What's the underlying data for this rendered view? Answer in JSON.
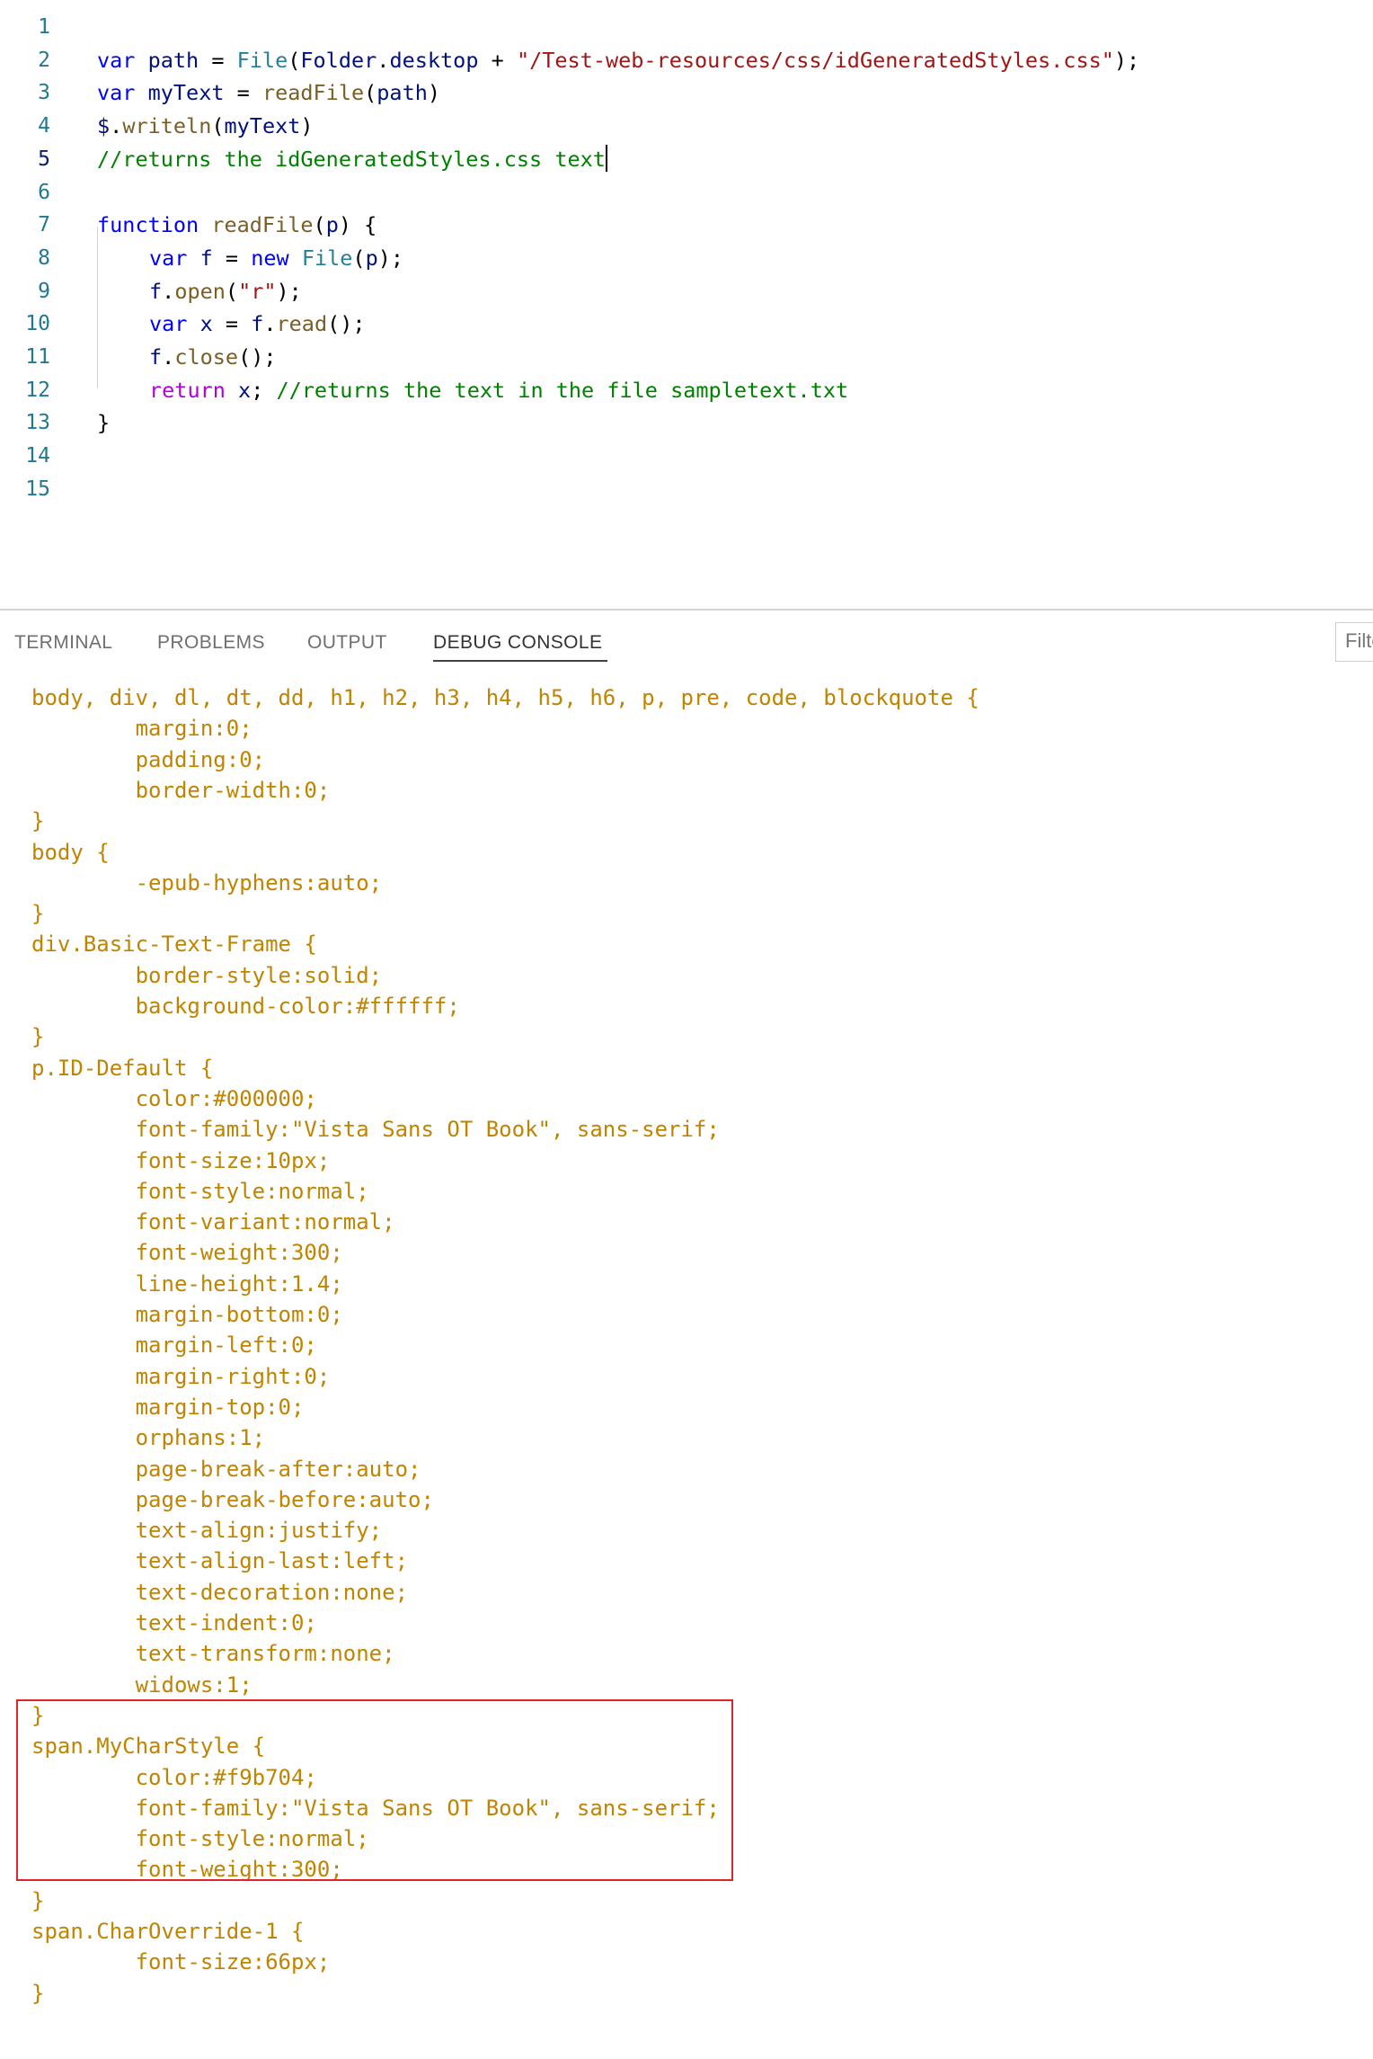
{
  "editor": {
    "line_numbers": [
      "1",
      "2",
      "3",
      "4",
      "5",
      "6",
      "7",
      "8",
      "9",
      "10",
      "11",
      "12",
      "13",
      "14",
      "15"
    ],
    "active_line": 5,
    "lines": [
      [],
      [
        {
          "t": "var",
          "c": "kw"
        },
        {
          "t": " path ",
          "c": "var"
        },
        {
          "t": "= ",
          "c": "plain"
        },
        {
          "t": "File",
          "c": "type"
        },
        {
          "t": "(",
          "c": "plain"
        },
        {
          "t": "Folder",
          "c": "var"
        },
        {
          "t": ".",
          "c": "plain"
        },
        {
          "t": "desktop",
          "c": "var"
        },
        {
          "t": " + ",
          "c": "plain"
        },
        {
          "t": "\"/Test-web-resources/css/idGeneratedStyles.css\"",
          "c": "str"
        },
        {
          "t": ");",
          "c": "plain"
        }
      ],
      [
        {
          "t": "var",
          "c": "kw"
        },
        {
          "t": " myText ",
          "c": "var"
        },
        {
          "t": "= ",
          "c": "plain"
        },
        {
          "t": "readFile",
          "c": "fn"
        },
        {
          "t": "(",
          "c": "plain"
        },
        {
          "t": "path",
          "c": "var"
        },
        {
          "t": ")",
          "c": "plain"
        }
      ],
      [
        {
          "t": "$",
          "c": "var"
        },
        {
          "t": ".",
          "c": "plain"
        },
        {
          "t": "writeln",
          "c": "fn"
        },
        {
          "t": "(",
          "c": "plain"
        },
        {
          "t": "myText",
          "c": "var"
        },
        {
          "t": ")",
          "c": "plain"
        }
      ],
      [
        {
          "t": "//returns the idGeneratedStyles.css text",
          "c": "cmt"
        }
      ],
      [],
      [
        {
          "t": "function",
          "c": "kw"
        },
        {
          "t": " ",
          "c": "plain"
        },
        {
          "t": "readFile",
          "c": "fn"
        },
        {
          "t": "(",
          "c": "plain"
        },
        {
          "t": "p",
          "c": "var"
        },
        {
          "t": ") {",
          "c": "plain"
        }
      ],
      [
        {
          "t": "var",
          "c": "kw"
        },
        {
          "t": " f ",
          "c": "var"
        },
        {
          "t": "= ",
          "c": "plain"
        },
        {
          "t": "new",
          "c": "kw"
        },
        {
          "t": " ",
          "c": "plain"
        },
        {
          "t": "File",
          "c": "type"
        },
        {
          "t": "(",
          "c": "plain"
        },
        {
          "t": "p",
          "c": "var"
        },
        {
          "t": ");",
          "c": "plain"
        }
      ],
      [
        {
          "t": "f",
          "c": "var"
        },
        {
          "t": ".",
          "c": "plain"
        },
        {
          "t": "open",
          "c": "fn"
        },
        {
          "t": "(",
          "c": "plain"
        },
        {
          "t": "\"r\"",
          "c": "str"
        },
        {
          "t": ");",
          "c": "plain"
        }
      ],
      [
        {
          "t": "var",
          "c": "kw"
        },
        {
          "t": " x ",
          "c": "var"
        },
        {
          "t": "= ",
          "c": "plain"
        },
        {
          "t": "f",
          "c": "var"
        },
        {
          "t": ".",
          "c": "plain"
        },
        {
          "t": "read",
          "c": "fn"
        },
        {
          "t": "();",
          "c": "plain"
        }
      ],
      [
        {
          "t": "f",
          "c": "var"
        },
        {
          "t": ".",
          "c": "plain"
        },
        {
          "t": "close",
          "c": "fn"
        },
        {
          "t": "();",
          "c": "plain"
        }
      ],
      [
        {
          "t": "return",
          "c": "ctl"
        },
        {
          "t": " x",
          "c": "var"
        },
        {
          "t": "; ",
          "c": "plain"
        },
        {
          "t": "//returns the text in the file sampletext.txt",
          "c": "cmt"
        }
      ],
      [
        {
          "t": "}",
          "c": "plain"
        }
      ],
      [],
      []
    ]
  },
  "panel": {
    "tabs": [
      {
        "label": "TERMINAL",
        "active": false
      },
      {
        "label": "PROBLEMS",
        "active": false
      },
      {
        "label": "OUTPUT",
        "active": false
      },
      {
        "label": "DEBUG CONSOLE",
        "active": true
      }
    ],
    "filter_placeholder": "Filter (e.g. text, !exclude)"
  },
  "console": {
    "text_color": "#c18401",
    "lines": [
      "body, div, dl, dt, dd, h1, h2, h3, h4, h5, h6, p, pre, code, blockquote {",
      "        margin:0;",
      "        padding:0;",
      "        border-width:0;",
      "}",
      "body {",
      "        -epub-hyphens:auto;",
      "}",
      "div.Basic-Text-Frame {",
      "        border-style:solid;",
      "        background-color:#ffffff;",
      "}",
      "p.ID-Default {",
      "        color:#000000;",
      "        font-family:\"Vista Sans OT Book\", sans-serif;",
      "        font-size:10px;",
      "        font-style:normal;",
      "        font-variant:normal;",
      "        font-weight:300;",
      "        line-height:1.4;",
      "        margin-bottom:0;",
      "        margin-left:0;",
      "        margin-right:0;",
      "        margin-top:0;",
      "        orphans:1;",
      "        page-break-after:auto;",
      "        page-break-before:auto;",
      "        text-align:justify;",
      "        text-align-last:left;",
      "        text-decoration:none;",
      "        text-indent:0;",
      "        text-transform:none;",
      "        widows:1;",
      "}",
      "span.MyCharStyle {",
      "        color:#f9b704;",
      "        font-family:\"Vista Sans OT Book\", sans-serif;",
      "        font-style:normal;",
      "        font-weight:300;",
      "}",
      "span.CharOverride-1 {",
      "        font-size:66px;",
      "}"
    ]
  },
  "annotation": {
    "box_color": "#e0242b"
  }
}
